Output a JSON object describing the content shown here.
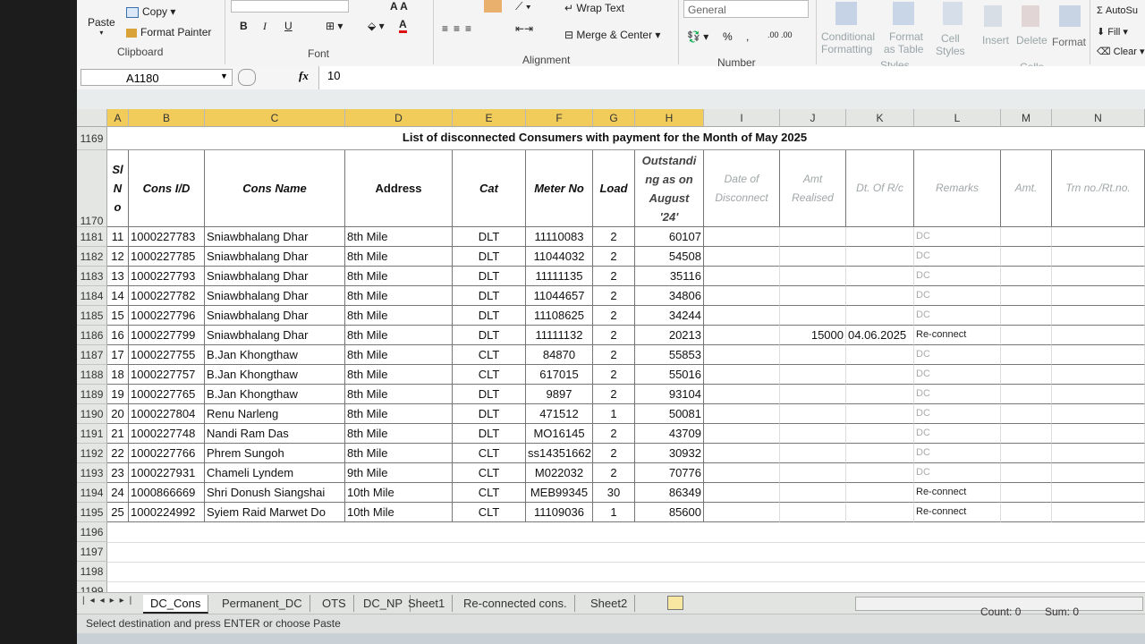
{
  "ribbon": {
    "clipboard": {
      "paste": "Paste",
      "copy": "Copy",
      "format_painter": "Format Painter",
      "title": "Clipboard"
    },
    "font": {
      "title": "Font",
      "bold": "B",
      "italic": "I",
      "underline": "U",
      "font_color": "A"
    },
    "alignment": {
      "wrap_text": "Wrap Text",
      "merge_center": "Merge & Center",
      "title": "Alignment"
    },
    "number": {
      "format": "General",
      "percent": "%",
      "comma": ",",
      "title": "Number"
    },
    "styles": {
      "conditional": "Conditional",
      "conditional2": "Formatting",
      "format_table": "Format",
      "format_table2": "as Table",
      "cell_styles": "Cell",
      "cell_styles2": "Styles",
      "title": "Styles"
    },
    "cells": {
      "insert": "Insert",
      "delete": "Delete",
      "format": "Format",
      "title": "Cells"
    },
    "editing": {
      "autosum": "AutoSu",
      "fill": "Fill",
      "clear": "Clear"
    }
  },
  "formula_bar": {
    "name_box": "A1180",
    "fx": "fx",
    "value": "10"
  },
  "columns": [
    "A",
    "B",
    "C",
    "D",
    "E",
    "F",
    "G",
    "H",
    "I",
    "J",
    "K",
    "L",
    "M",
    "N"
  ],
  "sheet": {
    "title_row": "1169",
    "title": "List of disconnected Consumers with payment for the Month of May 2025",
    "header_row": "1170",
    "headers": {
      "sl": [
        "Sl",
        "N",
        "o"
      ],
      "cons_id": "Cons I/D",
      "cons_name": "Cons Name",
      "address": "Address",
      "cat": "Cat",
      "meter": "Meter No",
      "load": "Load",
      "outstanding": [
        "Outstandi",
        "ng as on",
        "August",
        "'24'"
      ],
      "date_disc": [
        "Date of",
        "Disconnect"
      ],
      "amt_realised": [
        "Amt",
        "Realised"
      ],
      "dt_rc": "Dt. Of R/c",
      "remarks": "Remarks",
      "amt": "Amt.",
      "trn": "Trn no./Rt.no."
    },
    "rows": [
      {
        "row": "1181",
        "sl": "11",
        "id": "1000227783",
        "name": "Sniawbhalang Dhar",
        "addr": "8th Mile",
        "cat": "DLT",
        "meter": "11110083",
        "load": "2",
        "out": "60107",
        "amt": "",
        "dt": "",
        "rem": "DC"
      },
      {
        "row": "1182",
        "sl": "12",
        "id": "1000227785",
        "name": "Sniawbhalang Dhar",
        "addr": "8th Mile",
        "cat": "DLT",
        "meter": "11044032",
        "load": "2",
        "out": "54508",
        "amt": "",
        "dt": "",
        "rem": "DC"
      },
      {
        "row": "1183",
        "sl": "13",
        "id": "1000227793",
        "name": "Sniawbhalang Dhar",
        "addr": "8th Mile",
        "cat": "DLT",
        "meter": "11111135",
        "load": "2",
        "out": "35116",
        "amt": "",
        "dt": "",
        "rem": "DC"
      },
      {
        "row": "1184",
        "sl": "14",
        "id": "1000227782",
        "name": "Sniawbhalang Dhar",
        "addr": "8th Mile",
        "cat": "DLT",
        "meter": "11044657",
        "load": "2",
        "out": "34806",
        "amt": "",
        "dt": "",
        "rem": "DC"
      },
      {
        "row": "1185",
        "sl": "15",
        "id": "1000227796",
        "name": "Sniawbhalang Dhar",
        "addr": "8th Mile",
        "cat": "DLT",
        "meter": "11108625",
        "load": "2",
        "out": "34244",
        "amt": "",
        "dt": "",
        "rem": "DC"
      },
      {
        "row": "1186",
        "sl": "16",
        "id": "1000227799",
        "name": "Sniawbhalang Dhar",
        "addr": "8th Mile",
        "cat": "DLT",
        "meter": "11111132",
        "load": "2",
        "out": "20213",
        "amt": "15000",
        "dt": "04.06.2025",
        "rem": "Re-connect"
      },
      {
        "row": "1187",
        "sl": "17",
        "id": "1000227755",
        "name": "B.Jan Khongthaw",
        "addr": "8th Mile",
        "cat": "CLT",
        "meter": "84870",
        "load": "2",
        "out": "55853",
        "amt": "",
        "dt": "",
        "rem": "DC"
      },
      {
        "row": "1188",
        "sl": "18",
        "id": "1000227757",
        "name": "B.Jan Khongthaw",
        "addr": "8th Mile",
        "cat": "CLT",
        "meter": "617015",
        "load": "2",
        "out": "55016",
        "amt": "",
        "dt": "",
        "rem": "DC"
      },
      {
        "row": "1189",
        "sl": "19",
        "id": "1000227765",
        "name": "B.Jan Khongthaw",
        "addr": "8th Mile",
        "cat": "DLT",
        "meter": "9897",
        "load": "2",
        "out": "93104",
        "amt": "",
        "dt": "",
        "rem": "DC"
      },
      {
        "row": "1190",
        "sl": "20",
        "id": "1000227804",
        "name": "Renu Narleng",
        "addr": "8th Mile",
        "cat": "DLT",
        "meter": "471512",
        "load": "1",
        "out": "50081",
        "amt": "",
        "dt": "",
        "rem": "DC"
      },
      {
        "row": "1191",
        "sl": "21",
        "id": "1000227748",
        "name": "Nandi Ram Das",
        "addr": "8th Mile",
        "cat": "DLT",
        "meter": "MO16145",
        "load": "2",
        "out": "43709",
        "amt": "",
        "dt": "",
        "rem": "DC"
      },
      {
        "row": "1192",
        "sl": "22",
        "id": "1000227766",
        "name": "Phrem Sungoh",
        "addr": "8th Mile",
        "cat": "CLT",
        "meter": "ss14351662",
        "load": "2",
        "out": "30932",
        "amt": "",
        "dt": "",
        "rem": "DC"
      },
      {
        "row": "1193",
        "sl": "23",
        "id": "1000227931",
        "name": "Chameli Lyndem",
        "addr": "9th Mile",
        "cat": "CLT",
        "meter": "M022032",
        "load": "2",
        "out": "70776",
        "amt": "",
        "dt": "",
        "rem": "DC"
      },
      {
        "row": "1194",
        "sl": "24",
        "id": "1000866669",
        "name": "Shri Donush Siangshai",
        "addr": "10th Mile",
        "cat": "CLT",
        "meter": "MEB99345",
        "load": "30",
        "out": "86349",
        "amt": "",
        "dt": "",
        "rem": "Re-connect"
      },
      {
        "row": "1195",
        "sl": "25",
        "id": "1000224992",
        "name": "Syiem Raid Marwet Do",
        "addr": "10th Mile",
        "cat": "CLT",
        "meter": "11109036",
        "load": "1",
        "out": "85600",
        "amt": "",
        "dt": "",
        "rem": "Re-connect"
      }
    ],
    "empty_rows": [
      "1196",
      "1197",
      "1198",
      "1199"
    ]
  },
  "tabs": [
    "DC_Cons",
    "Permanent_DC",
    "OTS",
    "DC_NP",
    "Sheet1",
    "Re-connected cons.",
    "Sheet2"
  ],
  "active_tab": "DC_Cons",
  "status": {
    "message": "Select destination and press ENTER or choose Paste",
    "count": "Count: 0",
    "sum": "Sum: 0"
  },
  "colors": {
    "selected_col": "#f1cc5a",
    "grid_border": "#777777",
    "accent": "#1f6e43"
  }
}
